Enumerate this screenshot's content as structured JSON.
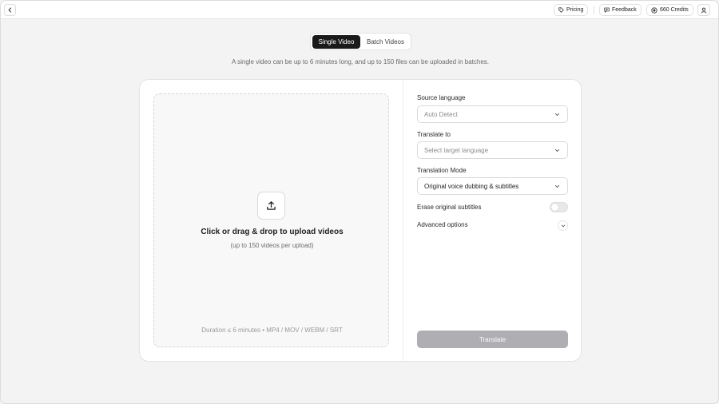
{
  "header": {
    "pricing_label": "Pricing",
    "feedback_label": "Feedback",
    "credits_label": "660 Credits"
  },
  "tabs": [
    {
      "label": "Single Video",
      "active": true
    },
    {
      "label": "Batch Videos",
      "active": false
    }
  ],
  "subtitle": "A single video can be up to 6 minutes long, and up to 150 files can be uploaded in batches.",
  "upload": {
    "title": "Click or drag & drop to upload videos",
    "subtitle": "(up to 150 videos per upload)",
    "footer": "Duration ≤ 6 minutes • MP4 / MOV / WEBM / SRT"
  },
  "form": {
    "source_language": {
      "label": "Source language",
      "value": "Auto Detect"
    },
    "translate_to": {
      "label": "Translate to",
      "placeholder": "Select target language"
    },
    "translation_mode": {
      "label": "Translation Mode",
      "value": "Original voice dubbing & subtitles"
    },
    "erase_subtitles": {
      "label": "Erase original subtitles",
      "enabled": false
    },
    "advanced_label": "Advanced options",
    "translate_button": "Translate"
  },
  "colors": {
    "accent_dark": "#1a1a1a",
    "button_disabled": "#aeaeb3",
    "background": "#f3f3f3"
  }
}
